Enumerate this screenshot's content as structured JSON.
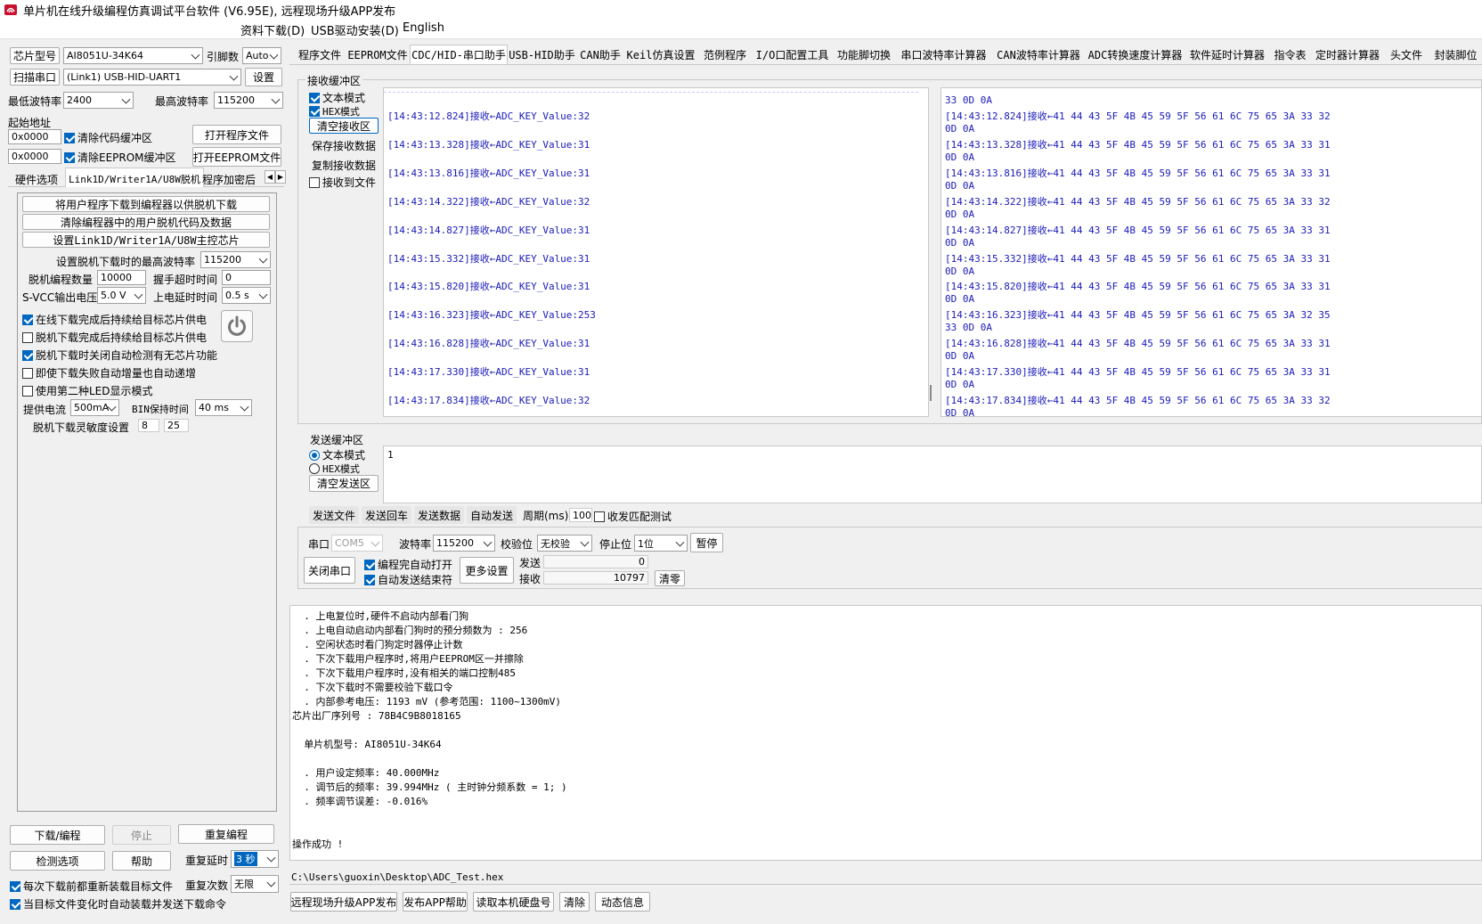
{
  "window": {
    "title": "单片机在线升级编程仿真调试平台软件 (V6.95E), 远程现场升级APP发布"
  },
  "menu": [
    "资料下载(D)",
    "USB驱动安装(D)",
    "English"
  ],
  "left": {
    "chip_btn": "芯片型号",
    "chip_value": "AI8051U-34K64",
    "pins_label": "引脚数",
    "pins_value": "Auto",
    "scan_btn": "扫描串口",
    "port_value": "(Link1) USB-HID-UART1",
    "settings_btn": "设置",
    "min_baud_label": "最低波特率",
    "min_baud": "2400",
    "max_baud_label": "最高波特率",
    "max_baud": "115200",
    "start_addr_label": "起始地址",
    "addr1": "0x0000",
    "clear_code": "清除代码缓冲区",
    "open_prog": "打开程序文件",
    "addr2": "0x0000",
    "clear_eeprom": "清除EEPROM缓冲区",
    "open_eeprom": "打开EEPROM文件",
    "subtabs": [
      "硬件选项",
      "Link1D/Writer1A/U8W脱机",
      "程序加密后"
    ],
    "offline": {
      "b1": "将用户程序下载到编程器以供脱机下载",
      "b2": "清除编程器中的用户脱机代码及数据",
      "b3": "设置Link1D/Writer1A/U8W主控芯片",
      "max_baud_label": "设置脱机下载时的最高波特率",
      "max_baud": "115200",
      "count_label": "脱机编程数量",
      "count": "10000",
      "handshake_label": "握手超时时间",
      "handshake": "0",
      "svcc_label": "S-VCC输出电压",
      "svcc": "5.0 V",
      "delay_label": "上电延时时间",
      "delay": "0.5 s",
      "c1": "在线下载完成后持续给目标芯片供电",
      "c2": "脱机下载完成后持续给目标芯片供电",
      "c3": "脱机下载时关闭自动检测有无芯片功能",
      "c4": "即使下载失败自动增量也自动递增",
      "c5": "使用第二种LED显示模式",
      "current_label": "提供电流",
      "current": "500mA",
      "bin_label": "BIN保持时间",
      "bin": "40 ms",
      "sens_label": "脱机下载灵敏度设置",
      "sens1": "8",
      "sens2": "25"
    },
    "download_btn": "下载/编程",
    "stop_btn": "停止",
    "reprog_btn": "重复编程",
    "detect_btn": "检测选项",
    "help_btn": "帮助",
    "repeat_delay_label": "重复延时",
    "repeat_delay": "3 秒",
    "repeat_count_label": "重复次数",
    "repeat_count": "无限",
    "reload_chk": "每次下载前都重新装载目标文件",
    "auto_chk": "当目标文件变化时自动装载并发送下载命令"
  },
  "tabs": [
    "程序文件",
    "EEPROM文件",
    "CDC/HID-串口助手",
    "USB-HID助手",
    "CAN助手",
    "Keil仿真设置",
    "范例程序",
    "I/O口配置工具",
    "功能脚切换",
    "串口波特率计算器",
    "CAN波特率计算器",
    "ADC转换速度计算器",
    "软件延时计算器",
    "指令表",
    "定时器计算器",
    "头文件",
    "封装脚位"
  ],
  "rx": {
    "title": "接收缓冲区",
    "text_mode": "文本模式",
    "hex_mode": "HEX模式",
    "clear": "清空接收区",
    "save": "保存接收数据",
    "copy": "复制接收数据",
    "to_file": "接收到文件",
    "text_lines": [
      "[14:43:12.824]接收←ADC_KEY_Value:32",
      "[14:43:13.328]接收←ADC_KEY_Value:31",
      "[14:43:13.816]接收←ADC_KEY_Value:31",
      "[14:43:14.322]接收←ADC_KEY_Value:32",
      "[14:43:14.827]接收←ADC_KEY_Value:31",
      "[14:43:15.332]接收←ADC_KEY_Value:31",
      "[14:43:15.820]接收←ADC_KEY_Value:31",
      "[14:43:16.323]接收←ADC_KEY_Value:253",
      "[14:43:16.828]接收←ADC_KEY_Value:31",
      "[14:43:17.330]接收←ADC_KEY_Value:31",
      "[14:43:17.834]接收←ADC_KEY_Value:32"
    ],
    "hex_top": "33 0D 0A",
    "hex_lines": [
      [
        "[14:43:12.824]接收←41 44 43 5F 4B 45 59 5F 56 61 6C 75 65 3A 33 32",
        "0D 0A"
      ],
      [
        "[14:43:13.328]接收←41 44 43 5F 4B 45 59 5F 56 61 6C 75 65 3A 33 31",
        "0D 0A"
      ],
      [
        "[14:43:13.816]接收←41 44 43 5F 4B 45 59 5F 56 61 6C 75 65 3A 33 31",
        "0D 0A"
      ],
      [
        "[14:43:14.322]接收←41 44 43 5F 4B 45 59 5F 56 61 6C 75 65 3A 33 32",
        "0D 0A"
      ],
      [
        "[14:43:14.827]接收←41 44 43 5F 4B 45 59 5F 56 61 6C 75 65 3A 33 31",
        "0D 0A"
      ],
      [
        "[14:43:15.332]接收←41 44 43 5F 4B 45 59 5F 56 61 6C 75 65 3A 33 31",
        "0D 0A"
      ],
      [
        "[14:43:15.820]接收←41 44 43 5F 4B 45 59 5F 56 61 6C 75 65 3A 33 31",
        "0D 0A"
      ],
      [
        "[14:43:16.323]接收←41 44 43 5F 4B 45 59 5F 56 61 6C 75 65 3A 32 35",
        "33 0D 0A"
      ],
      [
        "[14:43:16.828]接收←41 44 43 5F 4B 45 59 5F 56 61 6C 75 65 3A 33 31",
        "0D 0A"
      ],
      [
        "[14:43:17.330]接收←41 44 43 5F 4B 45 59 5F 56 61 6C 75 65 3A 33 31",
        "0D 0A"
      ],
      [
        "[14:43:17.834]接收←41 44 43 5F 4B 45 59 5F 56 61 6C 75 65 3A 33 32",
        "0D 0A"
      ]
    ]
  },
  "tx": {
    "title": "发送缓冲区",
    "text_mode": "文本模式",
    "hex_mode": "HEX模式",
    "clear": "清空发送区",
    "content": "1",
    "send_file": "发送文件",
    "send_enter": "发送回车",
    "send_data": "发送数据",
    "auto_send": "自动发送",
    "period_label": "周期(ms)",
    "period": "100",
    "match_test": "收发匹配测试"
  },
  "port": {
    "port_label": "串口",
    "port": "COM5",
    "baud_label": "波特率",
    "baud": "115200",
    "parity_label": "校验位",
    "parity": "无校验",
    "stop_label": "停止位",
    "stop": "1位",
    "pause": "暂停",
    "close": "关闭串口",
    "auto_open": "编程完自动打开",
    "auto_end": "自动发送结束符",
    "more": "更多设置",
    "send_label": "发送",
    "send_count": "0",
    "recv_label": "接收",
    "recv_count": "10797",
    "clear": "清零"
  },
  "log": [
    "  . 上电复位时,硬件不启动内部看门狗",
    "  . 上电自动启动内部看门狗时的预分频数为 : 256",
    "  . 空闲状态时看门狗定时器停止计数",
    "  . 下次下载用户程序时,将用户EEPROM区一并擦除",
    "  . 下次下载用户程序时,没有相关的端口控制485",
    "  . 下次下载时不需要校验下载口令",
    "  . 内部参考电压: 1193 mV (参考范围: 1100~1300mV)",
    "芯片出厂序列号 : 78B4C9B8018165",
    "",
    "  单片机型号: AI8051U-34K64",
    "",
    "  . 用户设定频率: 40.000MHz",
    "  . 调节后的频率: 39.994MHz ( 主时钟分频系数 = 1; )",
    "  . 频率调节误差: -0.016%",
    "",
    "",
    "操作成功 !"
  ],
  "file_path": "C:\\Users\\guoxin\\Desktop\\ADC_Test.hex",
  "bottom": [
    "远程现场升级APP发布",
    "发布APP帮助",
    "读取本机硬盘号",
    "清除",
    "动态信息"
  ]
}
